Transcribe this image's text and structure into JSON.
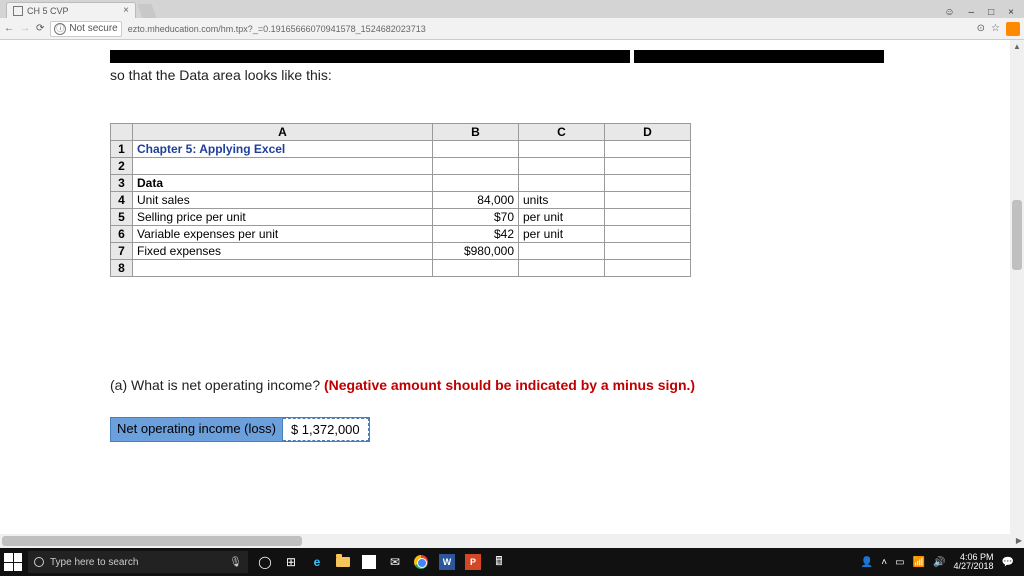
{
  "window": {
    "tab_title": "CH 5 CVP",
    "minimize": "–",
    "maximize": "□",
    "close": "×"
  },
  "address": {
    "not_secure": "Not secure",
    "url": "ezto.mheducation.com/hm.tpx?_=0.19165666070941578_1524682023713",
    "info_glyph": "ⓘ",
    "back": "←",
    "forward": "→",
    "reload": "⟳",
    "search_glyph": "⊙",
    "star": "☆"
  },
  "content": {
    "intro_line_tail": "so that the Data area looks like this:",
    "question_a": "(a) What is net operating income? ",
    "question_a_hint": "(Negative amount should be indicated by a minus sign.)",
    "answer_label": "Net operating income (loss)",
    "answer_value": "$ 1,372,000"
  },
  "spreadsheet": {
    "headers": {
      "A": "A",
      "B": "B",
      "C": "C",
      "D": "D"
    },
    "rows": [
      {
        "n": "1",
        "A": "Chapter 5: Applying Excel",
        "B": "",
        "C": "",
        "A_class": "blue-bold"
      },
      {
        "n": "2",
        "A": "",
        "B": "",
        "C": ""
      },
      {
        "n": "3",
        "A": "Data",
        "B": "",
        "C": "",
        "A_bold": true
      },
      {
        "n": "4",
        "A": "Unit sales",
        "B": "84,000",
        "C": "units"
      },
      {
        "n": "5",
        "A": "Selling price per unit",
        "B": "$70",
        "C": "per unit"
      },
      {
        "n": "6",
        "A": "Variable expenses per unit",
        "B": "$42",
        "C": "per unit"
      },
      {
        "n": "7",
        "A": "Fixed expenses",
        "B": "$980,000",
        "C": ""
      },
      {
        "n": "8",
        "A": "",
        "B": "",
        "C": ""
      }
    ]
  },
  "taskbar": {
    "search_placeholder": "Type here to search",
    "time": "4:06 PM",
    "date": "4/27/2018",
    "cortana": "◯",
    "taskview": "⊞",
    "mic": "🎙"
  }
}
